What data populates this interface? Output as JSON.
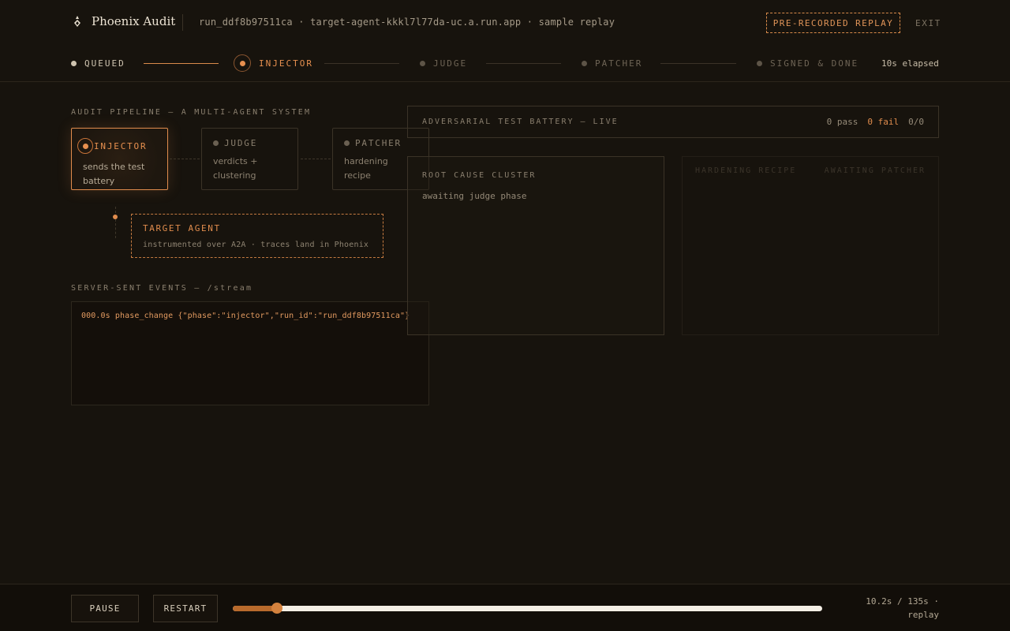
{
  "header": {
    "brand": "Phoenix Audit",
    "run_meta": "run_ddf8b97511ca · target-agent-kkkl7l77da-uc.a.run.app · sample replay",
    "replay_badge": "PRE-RECORDED REPLAY",
    "exit_label": "EXIT"
  },
  "stepper": {
    "steps": [
      {
        "label": "QUEUED",
        "state": "done"
      },
      {
        "label": "INJECTOR",
        "state": "active"
      },
      {
        "label": "JUDGE",
        "state": "pending"
      },
      {
        "label": "PATCHER",
        "state": "pending"
      },
      {
        "label": "SIGNED & DONE",
        "state": "pending"
      }
    ],
    "elapsed": "10s elapsed"
  },
  "pipeline": {
    "label": "AUDIT PIPELINE — A MULTI-AGENT SYSTEM",
    "agents": [
      {
        "title": "INJECTOR",
        "desc": "sends the test battery",
        "active": true
      },
      {
        "title": "JUDGE",
        "desc": "verdicts + clustering",
        "active": false
      },
      {
        "title": "PATCHER",
        "desc": "hardening recipe",
        "active": false
      }
    ],
    "target": {
      "title": "TARGET AGENT",
      "desc": "instrumented over A2A · traces land in Phoenix"
    }
  },
  "sse": {
    "label": "SERVER-SENT EVENTS — /stream",
    "lines": [
      "000.0s phase_change {\"phase\":\"injector\",\"run_id\":\"run_ddf8b97511ca\"}"
    ]
  },
  "battery": {
    "title": "ADVERSARIAL TEST BATTERY — LIVE",
    "pass": "0 pass",
    "fail": "0 fail",
    "ratio": "0/0"
  },
  "cluster": {
    "title": "ROOT CAUSE CLUSTER",
    "status": "awaiting judge phase"
  },
  "recipe": {
    "title": "HARDENING RECIPE",
    "status": "AWAITING PATCHER"
  },
  "controls": {
    "pause_label": "PAUSE",
    "restart_label": "RESTART",
    "progress_seconds": 10.2,
    "total_seconds": 135,
    "time_line1": "10.2s / 135s ·",
    "time_line2": "replay"
  },
  "colors": {
    "accent": "#e08c4d",
    "background": "#17130d"
  }
}
